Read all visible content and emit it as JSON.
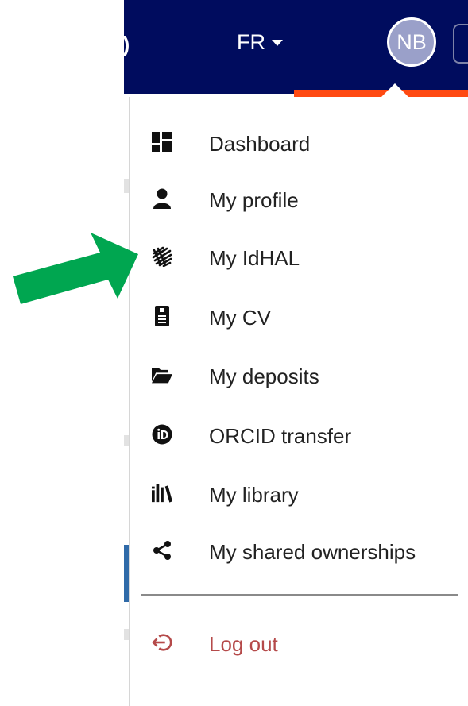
{
  "header": {
    "lang_label": "FR",
    "avatar_initials": "NB",
    "partial_glyph": ")"
  },
  "menu": {
    "items": [
      {
        "label": "Dashboard",
        "icon": "dashboard-icon"
      },
      {
        "label": "My profile",
        "icon": "user-icon"
      },
      {
        "label": "My IdHAL",
        "icon": "idhal-icon"
      },
      {
        "label": "My CV",
        "icon": "cv-icon"
      },
      {
        "label": "My deposits",
        "icon": "folder-open-icon"
      },
      {
        "label": "ORCID transfer",
        "icon": "orcid-icon"
      },
      {
        "label": "My library",
        "icon": "library-icon"
      },
      {
        "label": "My shared ownerships",
        "icon": "share-icon"
      }
    ],
    "logout_label": "Log out",
    "logout_icon": "logout-icon"
  },
  "colors": {
    "navbar": "#000c5e",
    "accent": "#ff4a12",
    "logout": "#b54a4a",
    "annotation_arrow": "#00a650"
  }
}
